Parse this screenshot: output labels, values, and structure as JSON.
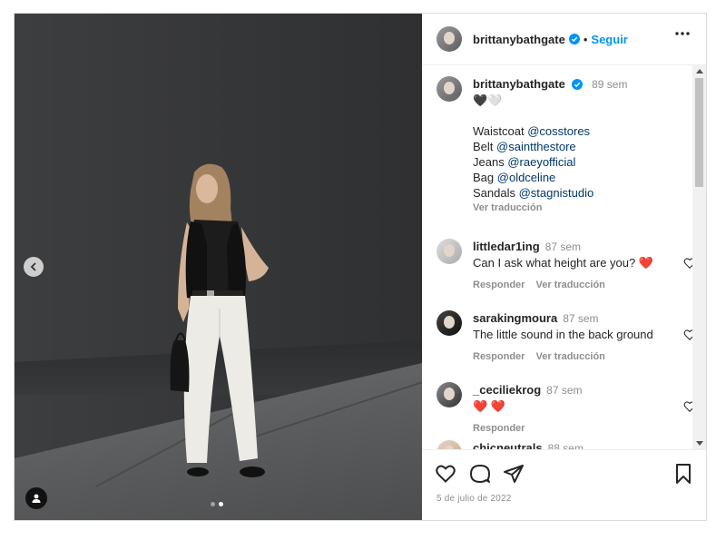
{
  "header": {
    "username": "brittanybathgate",
    "separator": "•",
    "follow_label": "Seguir",
    "more_icon": "more-horizontal-icon"
  },
  "caption": {
    "username": "brittanybathgate",
    "time": "89 sem",
    "emoji": "🖤🤍",
    "lines": [
      {
        "label": "Waistcoat",
        "mention": "@cosstores"
      },
      {
        "label": "Belt",
        "mention": "@saintthestore"
      },
      {
        "label": "Jeans",
        "mention": "@raeyofficial"
      },
      {
        "label": "Bag",
        "mention": "@oldceline"
      },
      {
        "label": "Sandals",
        "mention": "@stagnistudio"
      }
    ],
    "translate": "Ver traducción"
  },
  "comments": [
    {
      "username": "littledar1ing",
      "time": "87 sem",
      "text": "Can I ask what height are you?",
      "emoji": "❤️",
      "reply": "Responder",
      "translate": "Ver traducción"
    },
    {
      "username": "sarakingmoura",
      "time": "87 sem",
      "text": "The little sound in the back ground",
      "reply": "Responder",
      "translate": "Ver traducción"
    },
    {
      "username": "_ceciliekrog",
      "time": "87 sem",
      "emoji": "❤️ ❤️",
      "reply": "Responder"
    },
    {
      "username": "chicneutrals",
      "time": "88 sem"
    }
  ],
  "footer": {
    "date": "5 de julio de 2022"
  },
  "colors": {
    "link": "#0095f6",
    "mention": "#00376b",
    "muted": "#8e8e8e",
    "verified": "#0095f6",
    "heart": "#ed4956"
  },
  "carousel": {
    "current": 2,
    "total": 2
  }
}
